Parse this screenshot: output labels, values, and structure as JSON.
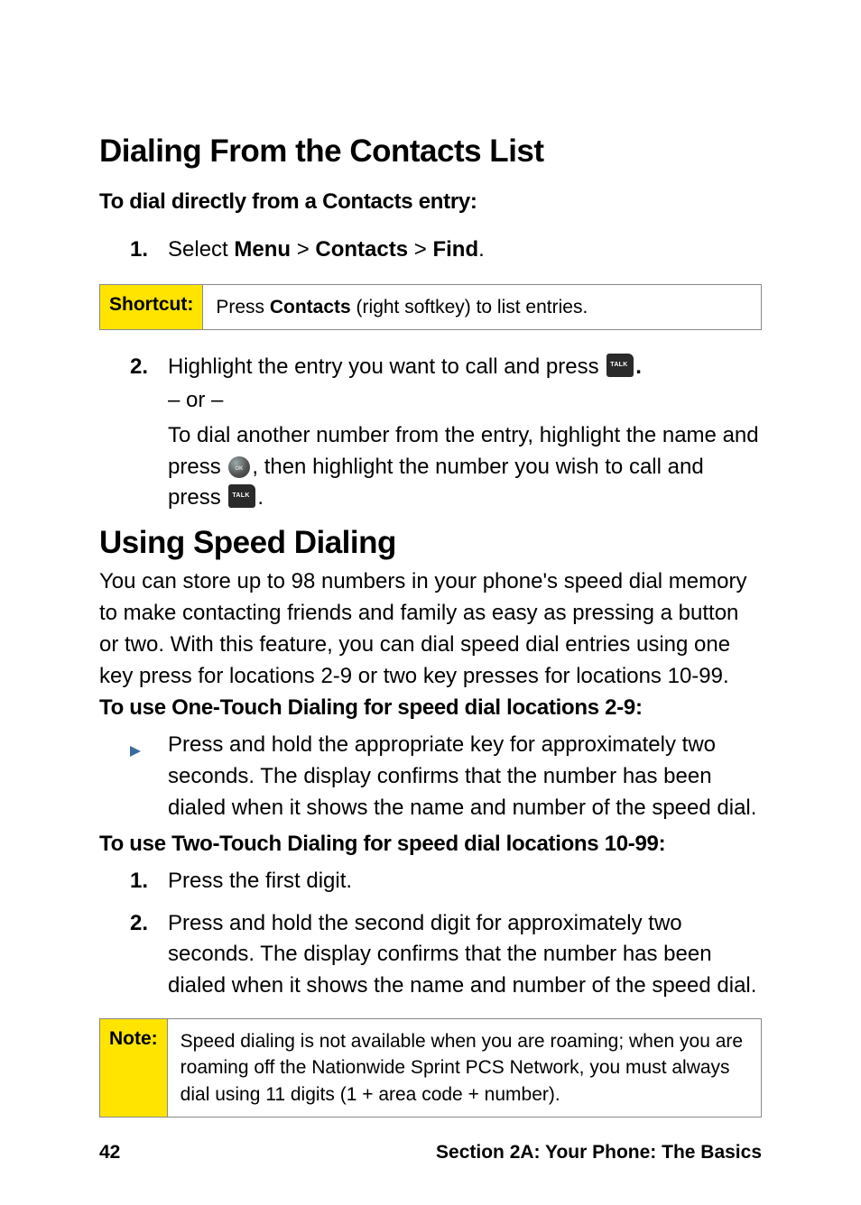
{
  "section1": {
    "title": "Dialing From the Contacts List",
    "subhead": "To dial directly from a Contacts entry:",
    "step1_num": "1.",
    "step1_prefix": "Select ",
    "step1_menu": "Menu",
    "step1_sep1": " > ",
    "step1_contacts": "Contacts",
    "step1_sep2": " > ",
    "step1_find": "Find",
    "step1_period": "."
  },
  "shortcut": {
    "label": "Shortcut:",
    "text_before": "Press ",
    "text_bold": "Contacts",
    "text_after": " (right softkey) to list entries."
  },
  "section1b": {
    "step2_num": "2.",
    "step2_line1_before": "Highlight the entry you want to call and press ",
    "step2_line1_after": ".",
    "or": "– or –",
    "step2_line2": "To dial another number from the entry, highlight the name and press ",
    "step2_line2_mid": ", then highlight the number you wish to call and press ",
    "step2_line2_end": "."
  },
  "section2": {
    "title": "Using Speed Dialing",
    "para": "You can store up to 98 numbers in your phone's speed dial memory to make contacting friends and family as easy as pressing a button or two. With this feature, you can dial speed dial entries using one key press for locations 2-9 or two key presses for locations 10-99.",
    "sub1": "To use One-Touch Dialing for speed dial locations 2-9:",
    "bullet": "Press and hold the appropriate key for approximately two seconds. The display confirms that the number has been dialed when it shows the name and number of the speed dial.",
    "sub2": "To use Two-Touch Dialing for speed dial locations 10-99:",
    "step1_num": "1.",
    "step1_text": "Press the first digit.",
    "step2_num": "2.",
    "step2_text": "Press and hold the second digit for approximately two seconds. The display confirms that the number has been dialed when it shows the name and number of the speed dial."
  },
  "note": {
    "label": "Note:",
    "text": "Speed dialing is not available when you are roaming; when you are roaming off the Nationwide Sprint PCS Network, you must always dial using 11 digits (1 + area code + number)."
  },
  "footer": {
    "page": "42",
    "section": "Section 2A: Your Phone: The Basics"
  }
}
